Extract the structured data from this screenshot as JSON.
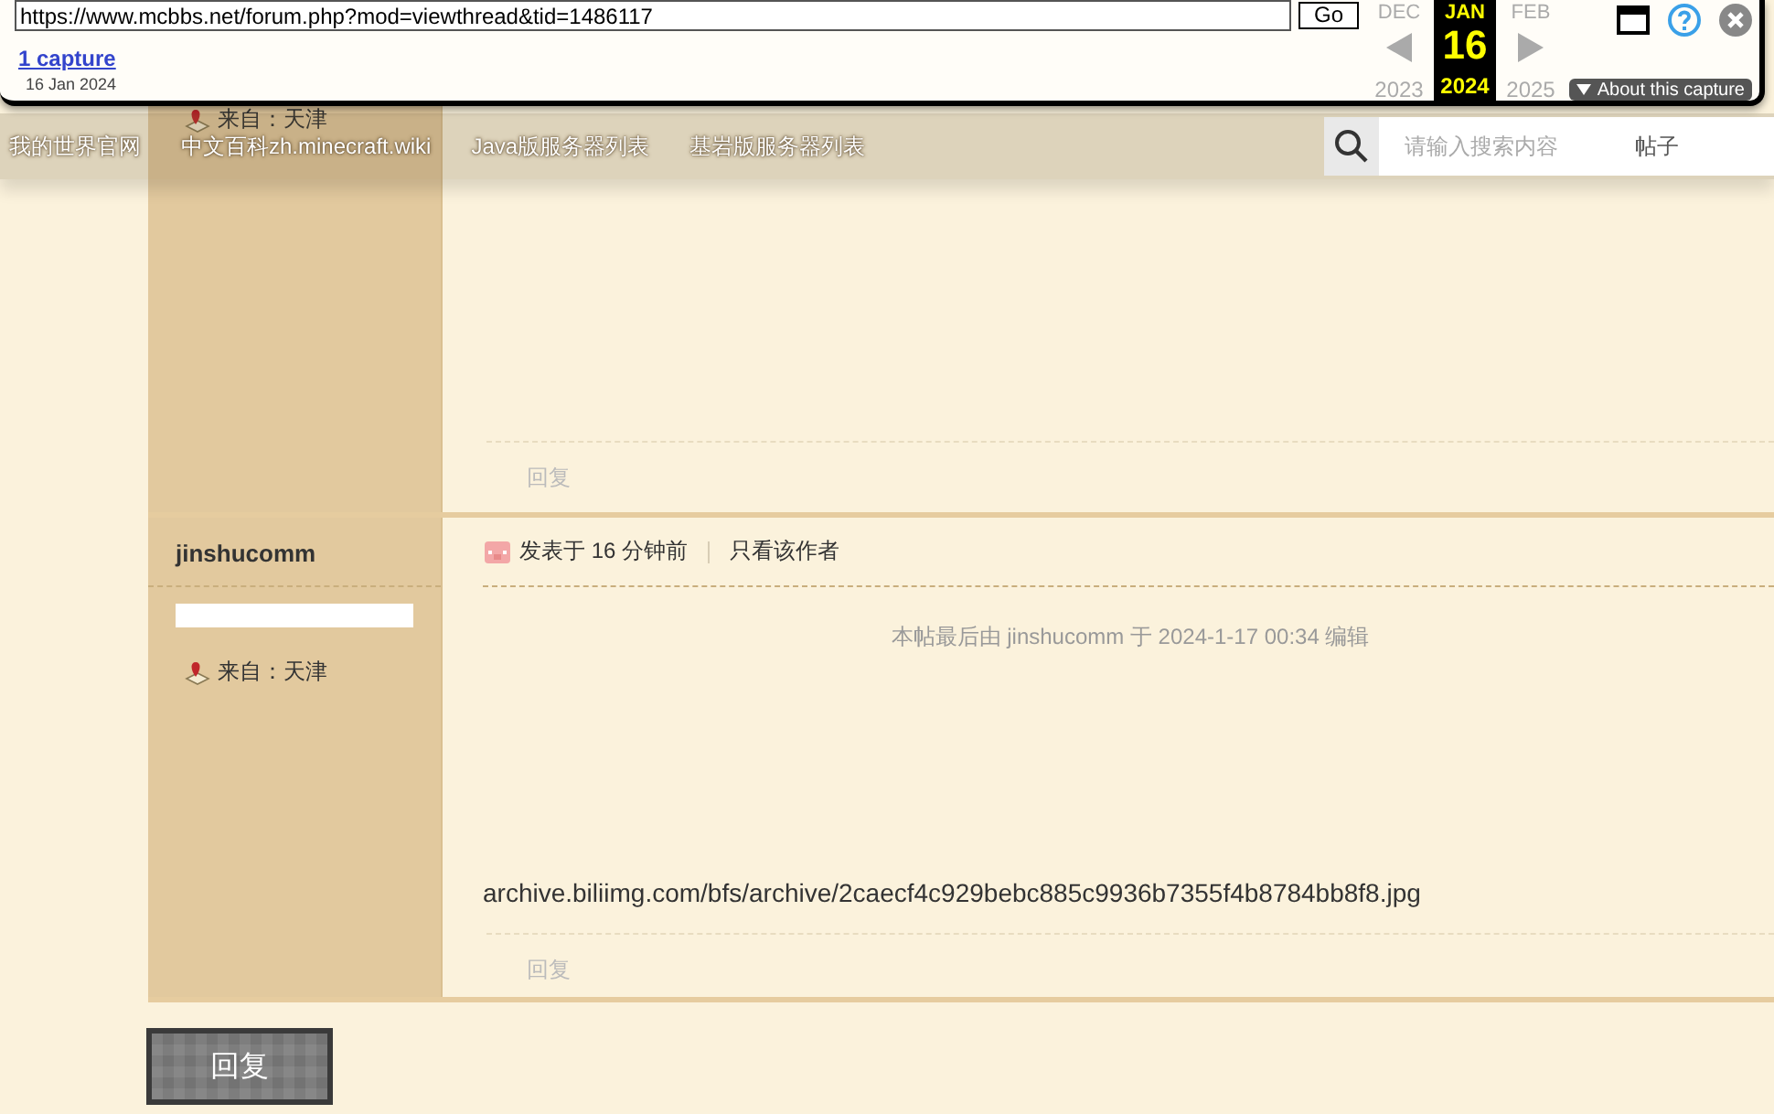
{
  "wayback": {
    "url": "https://www.mcbbs.net/forum.php?mod=viewthread&tid=1486117",
    "go_button": "Go",
    "captures_link": "1 capture",
    "capture_date": "16 Jan 2024",
    "months": [
      {
        "month": "DEC",
        "year": "2023",
        "selected": false
      },
      {
        "month": "JAN",
        "day": "16",
        "year": "2024",
        "selected": true
      },
      {
        "month": "FEB",
        "year": "2025",
        "selected": false
      }
    ],
    "about": "About this capture"
  },
  "nav": {
    "items": [
      "我的世界官网",
      "中文百科zh.minecraft.wiki",
      "Java版服务器列表",
      "基岩版服务器列表"
    ],
    "search": {
      "placeholder": "请输入搜索内容",
      "scope": "帖子"
    }
  },
  "posts": [
    {
      "location": "来自：天津",
      "reply": "回复"
    },
    {
      "author": "jinshucomm",
      "location": "来自：天津",
      "time": "发表于 16 分钟前",
      "only_author": "只看该作者",
      "edit_note": "本帖最后由 jinshucomm 于 2024-1-17 00:34 编辑",
      "body": "archive.biliimg.com/bfs/archive/2caecf4c929bebc885c9936b7355f4b8784bb8f8.jpg",
      "reply": "回复"
    }
  ],
  "reply_button": "回复"
}
